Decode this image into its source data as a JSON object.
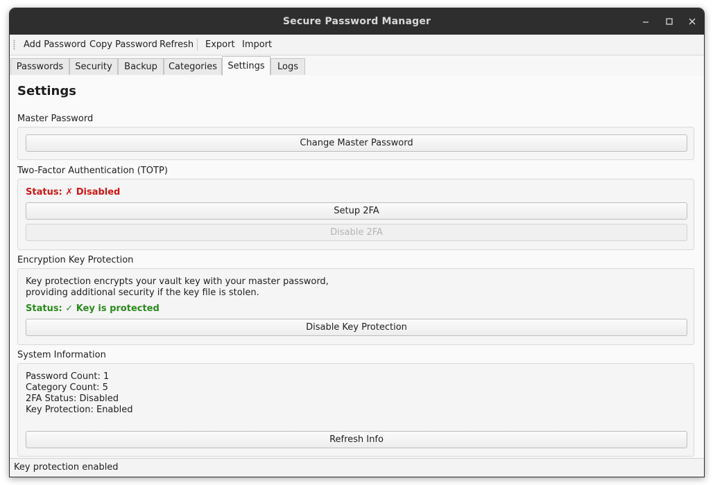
{
  "window": {
    "title": "Secure Password Manager"
  },
  "toolbar": {
    "items": [
      "Add Password",
      "Copy Password",
      "Refresh",
      "Export",
      "Import"
    ]
  },
  "tabs": [
    {
      "label": "Passwords",
      "active": false
    },
    {
      "label": "Security",
      "active": false
    },
    {
      "label": "Backup",
      "active": false
    },
    {
      "label": "Categories",
      "active": false
    },
    {
      "label": "Settings",
      "active": true
    },
    {
      "label": "Logs",
      "active": false
    }
  ],
  "settings": {
    "title": "Settings",
    "master_password": {
      "label": "Master Password",
      "change_button": "Change Master Password"
    },
    "two_factor": {
      "label": "Two-Factor Authentication (TOTP)",
      "status": "Status: ✗ Disabled",
      "setup_button": "Setup 2FA",
      "disable_button": "Disable 2FA"
    },
    "key_protection": {
      "label": "Encryption Key Protection",
      "description_line1": "Key protection encrypts your vault key with your master password,",
      "description_line2": "providing additional security if the key file is stolen.",
      "status": "Status: ✓ Key is protected",
      "disable_button": "Disable Key Protection"
    },
    "system_info": {
      "label": "System Information",
      "password_count": "Password Count: 1",
      "category_count": "Category Count: 5",
      "twofa_status": "2FA Status: Disabled",
      "key_protection": "Key Protection: Enabled",
      "refresh_button": "Refresh Info"
    }
  },
  "statusbar": {
    "message": "Key protection enabled"
  },
  "colors": {
    "status_disabled": "#d01616",
    "status_enabled": "#2a8a1e",
    "titlebar": "#2e2e2e"
  }
}
